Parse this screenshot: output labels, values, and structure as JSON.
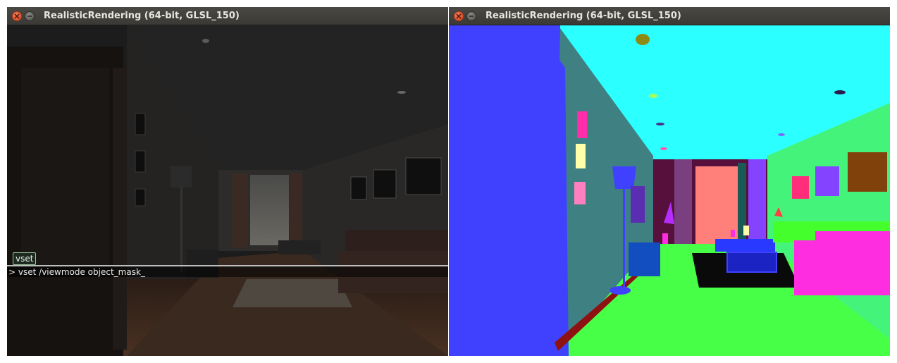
{
  "windows": [
    {
      "title": "RealisticRendering (64-bit, GLSL_150)",
      "view": "lit",
      "console": {
        "suggestion": "vset",
        "prompt": ">",
        "command": "vset /viewmode object_mask_"
      }
    },
    {
      "title": "RealisticRendering (64-bit, GLSL_150)",
      "view": "object_mask"
    }
  ],
  "icons": {
    "close": "close-icon",
    "minimize": "minimize-icon"
  },
  "colors": {
    "titlebar": "#3c3b37",
    "close_button": "#e5532d",
    "mask_floor": "#48ff48",
    "mask_ceiling": "#2cffff",
    "mask_left_wall": "#3f41ff",
    "mask_side_wall": "#3f8183",
    "mask_sofa": "#ff2de0"
  }
}
